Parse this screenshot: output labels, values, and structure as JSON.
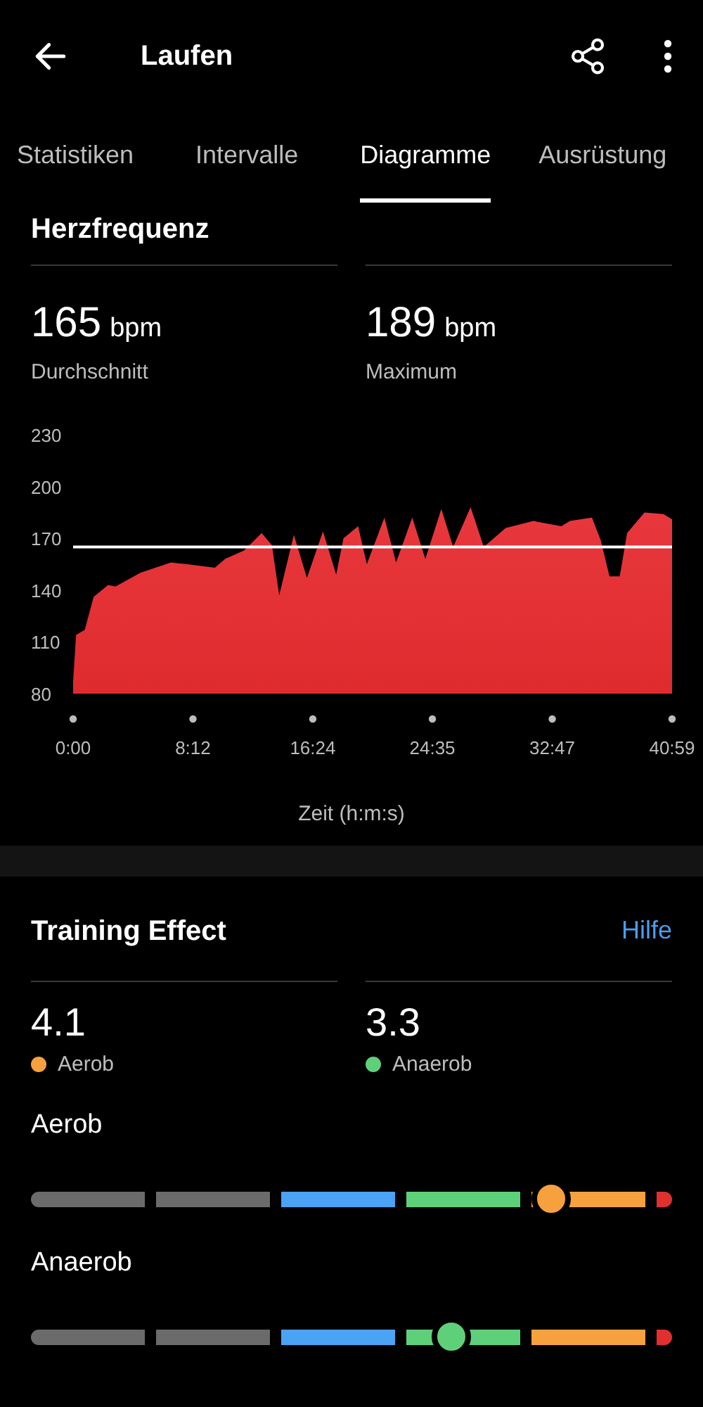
{
  "header": {
    "title": "Laufen"
  },
  "tabs": [
    {
      "label": "Statistiken",
      "selected": false
    },
    {
      "label": "Intervalle",
      "selected": false
    },
    {
      "label": "Diagramme",
      "selected": true
    },
    {
      "label": "Ausrüstung",
      "selected": false
    }
  ],
  "heart_rate": {
    "title": "Herzfrequenz",
    "stats": [
      {
        "value": "165",
        "unit": "bpm",
        "label": "Durchschnitt"
      },
      {
        "value": "189",
        "unit": "bpm",
        "label": "Maximum"
      }
    ],
    "chart_data": {
      "type": "area",
      "xlabel": "Zeit (h:m:s)",
      "x": [
        0,
        0.2,
        0.8,
        1.4,
        2.4,
        2.9,
        4.6,
        6.7,
        7.8,
        9.7,
        10.4,
        11.7,
        12.9,
        13.6,
        14.1,
        15.1,
        16.0,
        17.1,
        18.0,
        18.5,
        19.5,
        20.1,
        21.3,
        22.1,
        23.2,
        24.1,
        25.2,
        26.0,
        27.2,
        28.1,
        29.6,
        31.5,
        33.4,
        34.0,
        35.5,
        36.1,
        36.7,
        37.4,
        37.9,
        39.1,
        40.4,
        40.983
      ],
      "series": [
        {
          "color": "#e8383d",
          "values": [
            87,
            114,
            117,
            136,
            143,
            142,
            150,
            156,
            155,
            153,
            158,
            163,
            173,
            166,
            137,
            172,
            147,
            174,
            149,
            170,
            177,
            155,
            182,
            156,
            182,
            158,
            187,
            165,
            188,
            165,
            176,
            180,
            177,
            180,
            182,
            169,
            148,
            148,
            173,
            185,
            184,
            181
          ]
        }
      ],
      "xlim": [
        0,
        40.983
      ],
      "ylim": [
        80,
        230
      ],
      "xticks": [
        {
          "value": 0,
          "label": "0:00"
        },
        {
          "value": 8.2,
          "label": "8:12"
        },
        {
          "value": 16.4,
          "label": "16:24"
        },
        {
          "value": 24.583,
          "label": "24:35"
        },
        {
          "value": 32.783,
          "label": "32:47"
        },
        {
          "value": 40.983,
          "label": "40:59"
        }
      ],
      "yticks": [
        80,
        110,
        140,
        170,
        200,
        230
      ],
      "ref_lines": [
        {
          "axis": "y",
          "value": 165
        }
      ]
    }
  },
  "training_effect": {
    "title": "Training Effect",
    "help": "Hilfe",
    "scores": [
      {
        "value": "4.1",
        "label": "Aerob",
        "color": "#f7a13e"
      },
      {
        "value": "3.3",
        "label": "Anaerob",
        "color": "#5fd07a"
      }
    ],
    "scales": [
      {
        "title": "Aerob",
        "level": 0.82,
        "color": "#f7a13e"
      },
      {
        "title": "Anaerob",
        "level": 0.66,
        "color": "#5fd07a"
      }
    ]
  }
}
